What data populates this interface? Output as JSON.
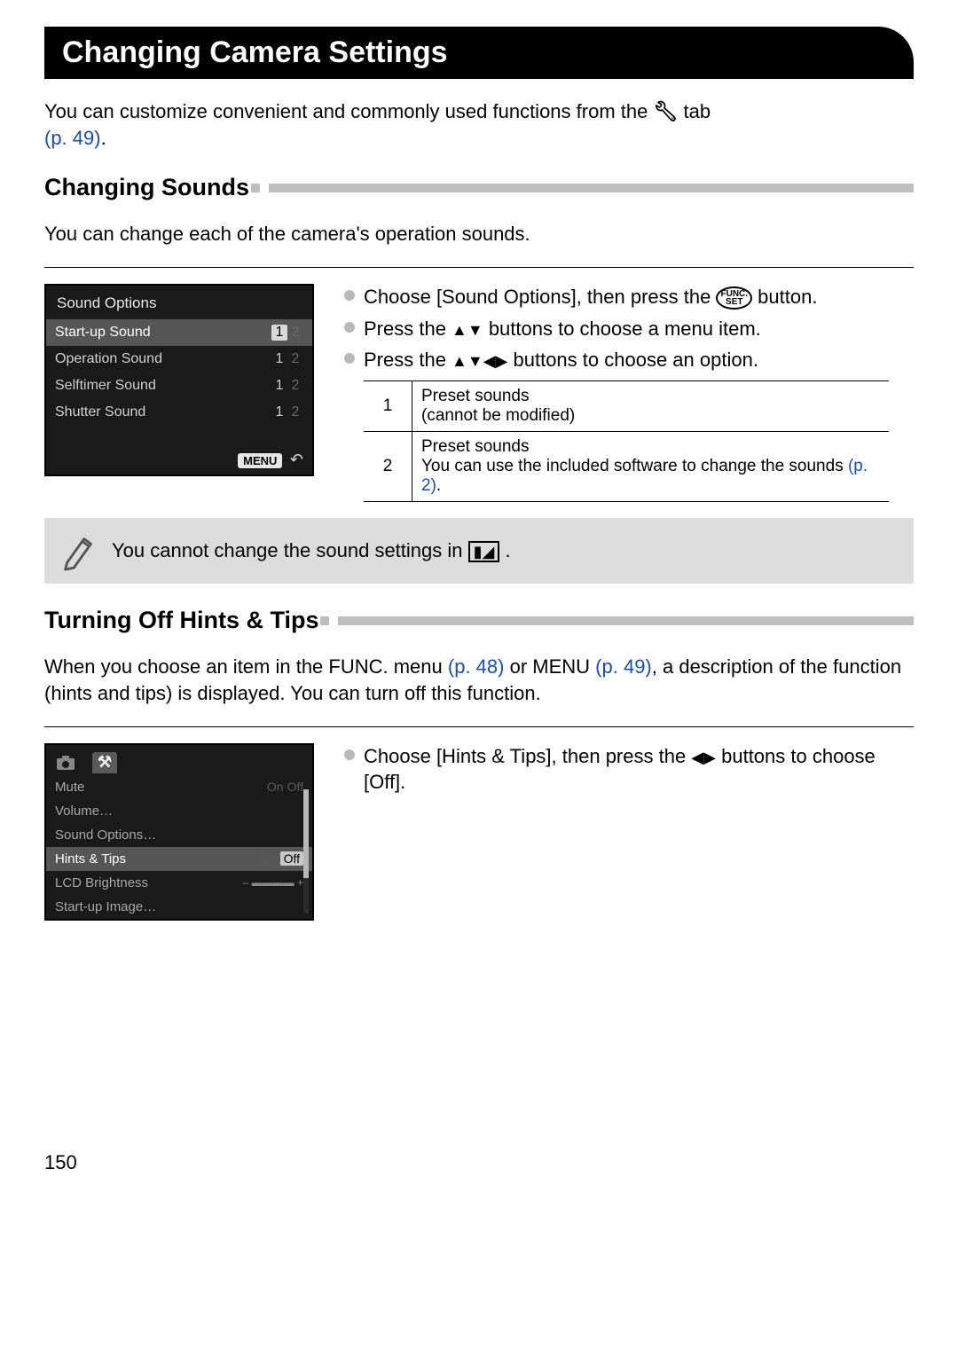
{
  "title": "Changing Camera Settings",
  "intro_part1": "You can customize convenient and commonly used functions from the ",
  "intro_part2": " tab ",
  "intro_link": "(p. 49)",
  "section1": {
    "heading": "Changing Sounds",
    "desc": "You can change each of the camera's operation sounds.",
    "cam_title": "Sound Options",
    "rows": [
      {
        "label": "Start-up Sound",
        "o1": "1",
        "o2": "2",
        "sel": true
      },
      {
        "label": "Operation Sound",
        "o1": "1",
        "o2": "2"
      },
      {
        "label": "Selftimer Sound",
        "o1": "1",
        "o2": "2"
      },
      {
        "label": "Shutter Sound",
        "o1": "1",
        "o2": "2"
      }
    ],
    "menu_label": "MENU",
    "bullets": {
      "b1a": "Choose [Sound Options], then press the ",
      "b1b": " button.",
      "b2a": "Press the ",
      "b2b": " buttons to choose a menu item.",
      "b3a": "Press the ",
      "b3b": " buttons to choose an option."
    },
    "table": [
      {
        "n": "1",
        "t1": "Preset sounds",
        "t2": "(cannot be modified)"
      },
      {
        "n": "2",
        "t1": "Preset sounds",
        "t2": "You can use the included software to change the sounds ",
        "link": "(p. 2)",
        "t3": "."
      }
    ],
    "note": "You cannot change the sound settings in "
  },
  "section2": {
    "heading": "Turning Off Hints & Tips",
    "desc1": "When you choose an item in the FUNC. menu ",
    "link1": "(p. 48)",
    "desc2": " or MENU ",
    "link2": "(p. 49)",
    "desc3": ", a description of the function (hints and tips) is displayed. You can turn off this function.",
    "menu": [
      {
        "label": "Mute",
        "val": "On Off",
        "cur": "Off"
      },
      {
        "label": "Volume…"
      },
      {
        "label": "Sound Options…"
      },
      {
        "label": "Hints & Tips",
        "val": "On Off",
        "cur": "Off",
        "sel": true
      },
      {
        "label": "LCD Brightness",
        "slider": true
      },
      {
        "label": "Start-up Image…"
      }
    ],
    "bullet": "Choose [Hints & Tips], then press the ",
    "bullet2": " buttons to choose [Off]."
  },
  "page_number": "150",
  "func_label": "FUNC.\nSET"
}
